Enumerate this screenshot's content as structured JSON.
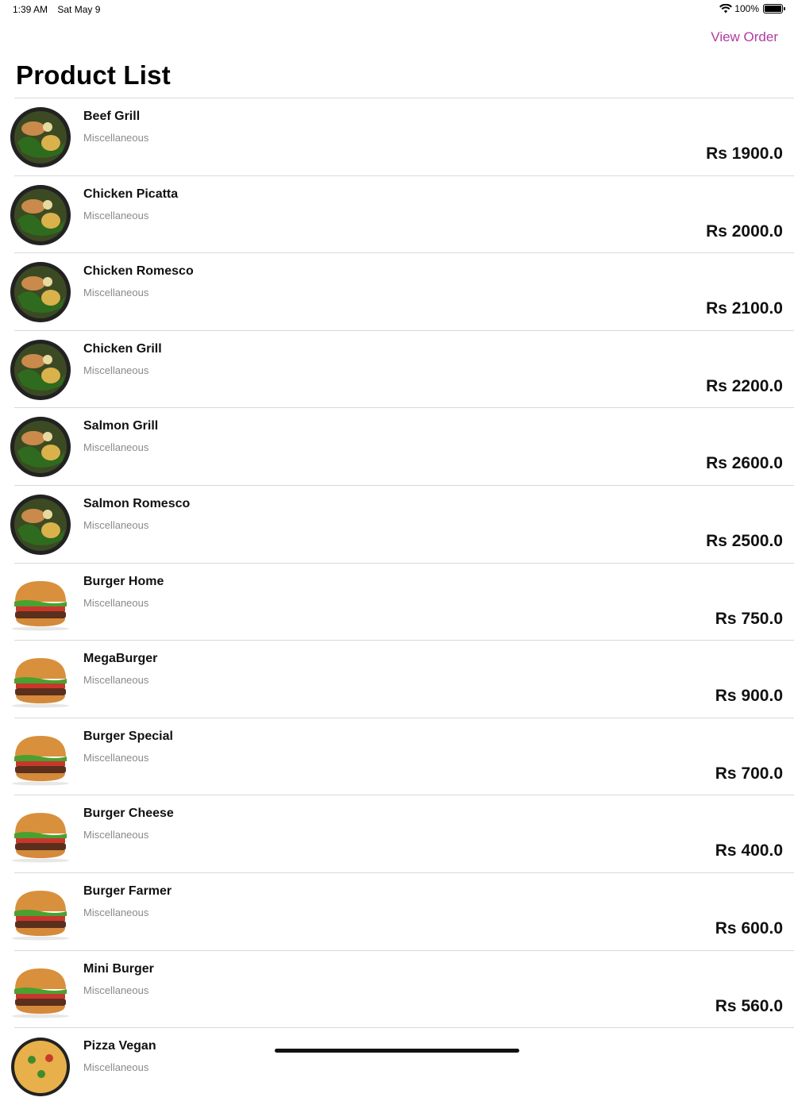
{
  "status_bar": {
    "time": "1:39 AM",
    "date": "Sat May 9",
    "battery": "100%",
    "icons": [
      "wifi-icon",
      "battery-icon"
    ]
  },
  "nav": {
    "action_label": "View Order",
    "accent_color": "#b33aa2"
  },
  "page": {
    "title": "Product List"
  },
  "products": [
    {
      "name": "Beef Grill",
      "category": "Miscellaneous",
      "price": "Rs 1900.0",
      "thumb": "bowl"
    },
    {
      "name": "Chicken Picatta",
      "category": "Miscellaneous",
      "price": "Rs 2000.0",
      "thumb": "bowl"
    },
    {
      "name": "Chicken Romesco",
      "category": "Miscellaneous",
      "price": "Rs 2100.0",
      "thumb": "bowl"
    },
    {
      "name": "Chicken Grill",
      "category": "Miscellaneous",
      "price": "Rs 2200.0",
      "thumb": "bowl"
    },
    {
      "name": "Salmon Grill",
      "category": "Miscellaneous",
      "price": "Rs 2600.0",
      "thumb": "bowl"
    },
    {
      "name": "Salmon Romesco",
      "category": "Miscellaneous",
      "price": "Rs 2500.0",
      "thumb": "bowl"
    },
    {
      "name": "Burger Home",
      "category": "Miscellaneous",
      "price": "Rs 750.0",
      "thumb": "burger"
    },
    {
      "name": "MegaBurger",
      "category": "Miscellaneous",
      "price": "Rs 900.0",
      "thumb": "burger"
    },
    {
      "name": "Burger Special",
      "category": "Miscellaneous",
      "price": "Rs 700.0",
      "thumb": "burger"
    },
    {
      "name": "Burger Cheese",
      "category": "Miscellaneous",
      "price": "Rs 400.0",
      "thumb": "burger"
    },
    {
      "name": "Burger Farmer",
      "category": "Miscellaneous",
      "price": "Rs 600.0",
      "thumb": "burger"
    },
    {
      "name": "Mini Burger",
      "category": "Miscellaneous",
      "price": "Rs 560.0",
      "thumb": "burger"
    },
    {
      "name": "Pizza Vegan",
      "category": "Miscellaneous",
      "price": "",
      "thumb": "pizza"
    }
  ]
}
